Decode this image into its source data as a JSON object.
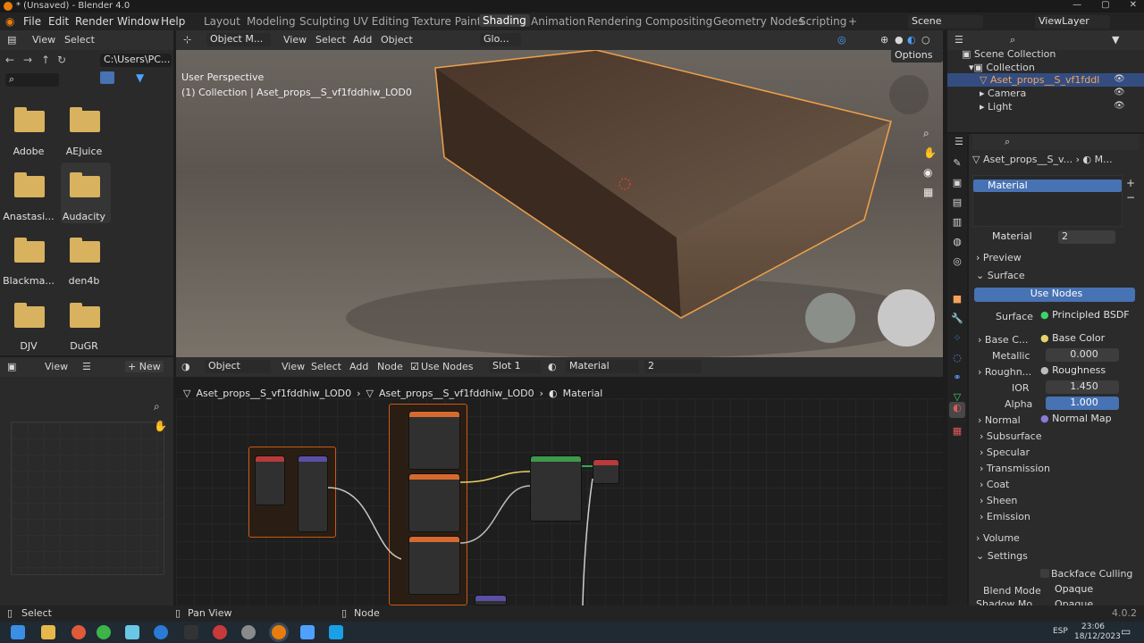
{
  "window": {
    "title": "* (Unsaved) - Blender 4.0",
    "controls": [
      "—",
      "▢",
      "✕"
    ]
  },
  "menu": [
    "File",
    "Edit",
    "Render",
    "Window",
    "Help"
  ],
  "workspaces": [
    "Layout",
    "Modeling",
    "Sculpting",
    "UV Editing",
    "Texture Paint",
    "Shading",
    "Animation",
    "Rendering",
    "Compositing",
    "Geometry Nodes",
    "Scripting",
    "+"
  ],
  "scene": {
    "label": "Scene",
    "viewlayer": "ViewLayer"
  },
  "filebrowser": {
    "menu": [
      "View",
      "Select"
    ],
    "path": "C:\\Users\\PC...",
    "folders": [
      "Adobe",
      "AEJuice",
      "Anastasi...",
      "Audacity",
      "Blackma...",
      "den4b",
      "DJV",
      "DuGR"
    ]
  },
  "viewport": {
    "mode": "Object M...",
    "menu": [
      "View",
      "Select",
      "Add",
      "Object"
    ],
    "transform": "Glo...",
    "options": "Options",
    "perspective": "User Perspective",
    "collection_info": "(1) Collection | Aset_props__S_vf1fddhiw_LOD0"
  },
  "image_editor": {
    "menu": [
      "View"
    ],
    "new_label": "+ New"
  },
  "node_editor": {
    "mode": "Object",
    "menu": [
      "View",
      "Select",
      "Add",
      "Node"
    ],
    "use_nodes": "Use Nodes",
    "slot": "Slot 1",
    "material": "Material",
    "users": "2",
    "breadcrumb": [
      "Aset_props__S_vf1fddhiw_LOD0",
      "Aset_props__S_vf1fddhiw_LOD0",
      "Material"
    ]
  },
  "outliner": {
    "items": [
      {
        "label": "Scene Collection"
      },
      {
        "label": "Collection"
      },
      {
        "label": "Aset_props__S_vf1fddl"
      },
      {
        "label": "Camera"
      },
      {
        "label": "Light"
      }
    ]
  },
  "properties": {
    "object_name": "Aset_props__S_v...",
    "material_short": "M...",
    "slot_material": "Material",
    "material_name": "Material",
    "users": "2",
    "preview": "Preview",
    "surface_section": "Surface",
    "use_nodes": "Use Nodes",
    "surface_label": "Surface",
    "surface_value": "Principled BSDF",
    "rows": [
      {
        "label": "Base C...",
        "value": "Base Color"
      },
      {
        "label": "Metallic",
        "value": "0.000"
      },
      {
        "label": "Roughn...",
        "value": "Roughness"
      },
      {
        "label": "IOR",
        "value": "1.450"
      },
      {
        "label": "Alpha",
        "value": "1.000"
      },
      {
        "label": "Normal",
        "value": "Normal Map"
      }
    ],
    "subsections": [
      "Subsurface",
      "Specular",
      "Transmission",
      "Coat",
      "Sheen",
      "Emission"
    ],
    "volume": "Volume",
    "settings": "Settings",
    "backface": "Backface Culling",
    "blend_label": "Blend Mode",
    "blend_value": "Opaque",
    "shadow_label": "Shadow Mo...",
    "shadow_value": "Opaque"
  },
  "status": {
    "select": "Select",
    "pan": "Pan View",
    "node": "Node",
    "version": "4.0.2"
  },
  "taskbar": {
    "lang": "ESP",
    "time": "23:06",
    "date": "18/12/2023"
  },
  "colors": {
    "accent": "#4772b3",
    "orange": "#e87d0d",
    "folder": "#d8b25e"
  }
}
